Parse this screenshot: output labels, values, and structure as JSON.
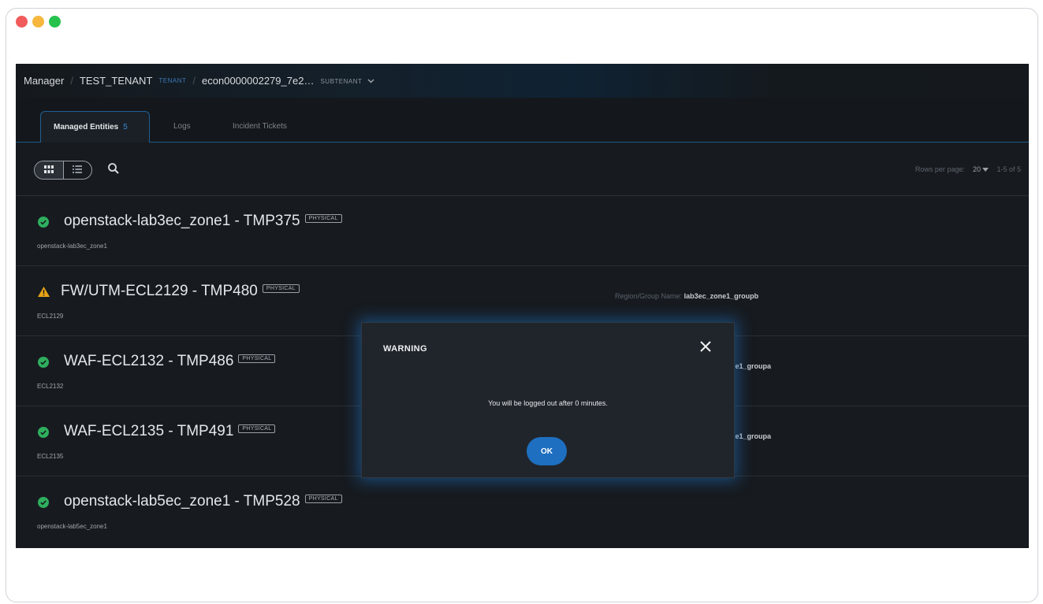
{
  "breadcrumb": {
    "root": "Manager",
    "tenant": "TEST_TENANT",
    "tenant_tag": "TENANT",
    "subtenant": "econ0000002279_7e2…",
    "subtenant_tag": "SUBTENANT"
  },
  "tabs": [
    {
      "label": "Managed Entities",
      "count": "5"
    },
    {
      "label": "Logs"
    },
    {
      "label": "Incident Tickets"
    }
  ],
  "toolbar": {
    "rows_per_page_label": "Rows per page:",
    "rows_per_page_value": "20",
    "range": "1-5 of 5"
  },
  "entities": [
    {
      "status": "ok",
      "name": "openstack-lab3ec_zone1 - TMP375",
      "badge": "PHYSICAL",
      "sub": "openstack-lab3ec_zone1",
      "region_label": "",
      "region_value": ""
    },
    {
      "status": "warning",
      "name": "FW/UTM-ECL2129 - TMP480",
      "badge": "PHYSICAL",
      "sub": "ECL2129",
      "region_label": "Region/Group Name:",
      "region_value": "lab3ec_zone1_groupb"
    },
    {
      "status": "ok",
      "name": "WAF-ECL2132 - TMP486",
      "badge": "PHYSICAL",
      "sub": "ECL2132",
      "region_label": "",
      "region_value": "zone1_groupa"
    },
    {
      "status": "ok",
      "name": "WAF-ECL2135 - TMP491",
      "badge": "PHYSICAL",
      "sub": "ECL2135",
      "region_label": "",
      "region_value": "zone1_groupa"
    },
    {
      "status": "ok",
      "name": "openstack-lab5ec_zone1 - TMP528",
      "badge": "PHYSICAL",
      "sub": "openstack-lab5ec_zone1",
      "region_label": "",
      "region_value": ""
    }
  ],
  "dialog": {
    "title": "WARNING",
    "message": "You will be logged out after 0 minutes.",
    "ok_label": "OK"
  },
  "colors": {
    "accent": "#1e6fc0",
    "status_ok": "#2fae5e",
    "status_warning": "#e8a317",
    "background": "#161a1e"
  }
}
